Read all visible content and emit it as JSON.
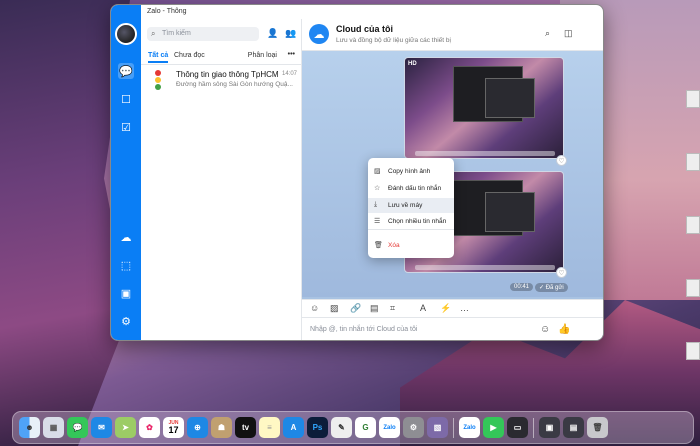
{
  "window": {
    "title": "Zalo - Thông"
  },
  "sidebar": {
    "items": [
      {
        "name": "chat"
      },
      {
        "name": "contacts"
      },
      {
        "name": "todo"
      },
      {
        "name": "cloud"
      },
      {
        "name": "capture"
      },
      {
        "name": "toolbox"
      },
      {
        "name": "settings"
      }
    ]
  },
  "list": {
    "search_placeholder": "Tìm kiếm",
    "tabs": {
      "all": "Tất cả",
      "unread": "Chưa đọc"
    },
    "filter": "Phân loại",
    "more": "•••",
    "conversations": [
      {
        "title": "Thông tin giao thông TpHCM",
        "time": "14:07",
        "preview": "Đường hầm sông Sài Gòn hướng Quậ..."
      }
    ]
  },
  "chat": {
    "title": "Cloud của tôi",
    "subtitle": "Lưu và đồng bộ dữ liệu giữa các thiết bị",
    "badge_hd": "HD",
    "time": "00:41",
    "sent": "✓ Đã gửi",
    "composer_placeholder": "Nhập @, tin nhắn tới Cloud của tôi"
  },
  "context_menu": {
    "items": [
      {
        "label": "Copy hình ảnh",
        "icon": "image-copy-icon"
      },
      {
        "label": "Đánh dấu tin nhắn",
        "icon": "star-icon"
      },
      {
        "label": "Lưu về máy",
        "icon": "download-icon"
      },
      {
        "label": "Chọn nhiều tin nhắn",
        "icon": "list-icon"
      },
      {
        "label": "Xóa",
        "icon": "trash-icon"
      }
    ]
  },
  "dock": {
    "calendar_day": "17",
    "calendar_month": "JUN",
    "zalo": "Zalo",
    "ps": "Ps",
    "tv": "tv"
  },
  "colors": {
    "accent": "#0a7ef5",
    "danger": "#e53935"
  }
}
